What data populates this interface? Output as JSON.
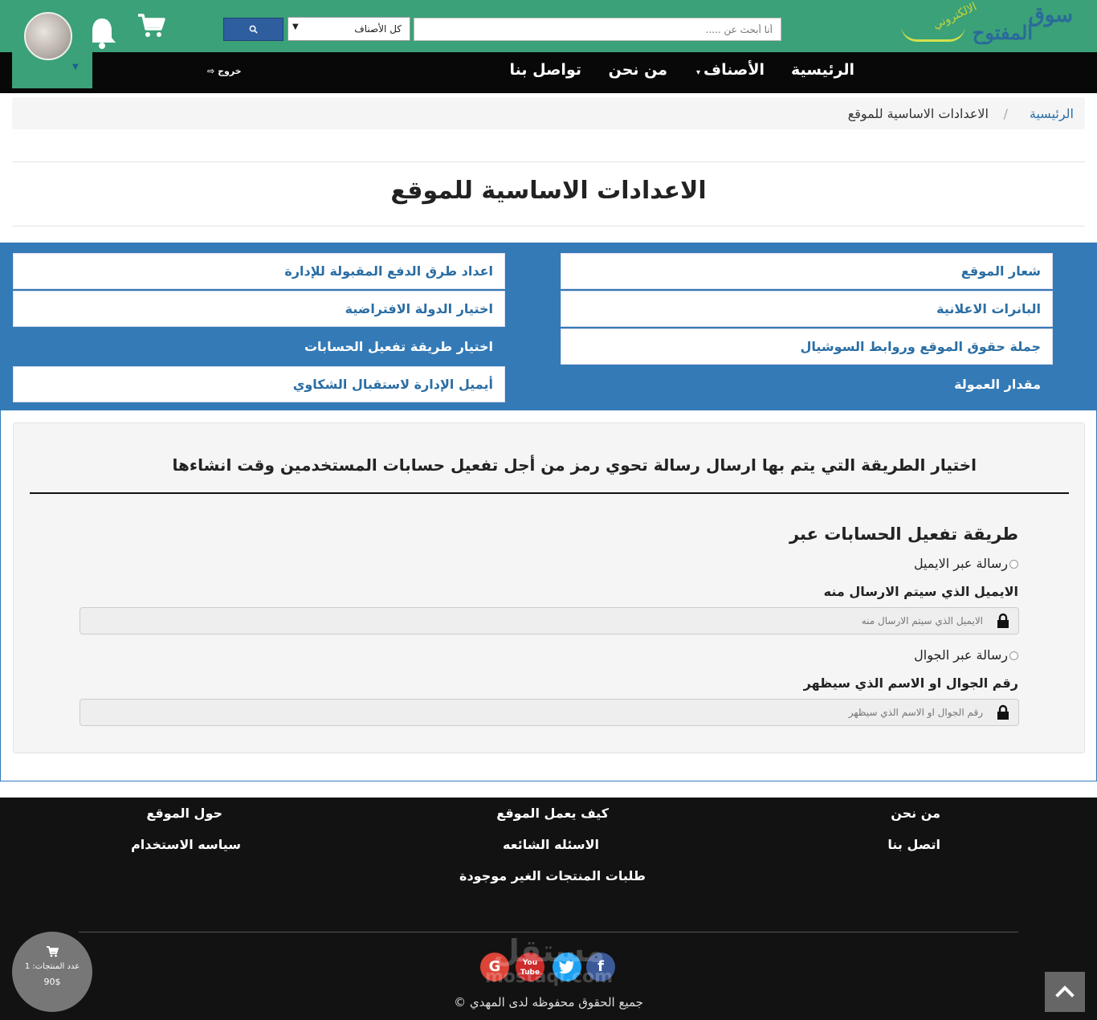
{
  "header": {
    "logo_text_1": "سوق",
    "logo_text_2": "المفتوح",
    "logo_text_3": "الالكتروني",
    "search_placeholder": "أنا أبحث عن .....",
    "category_selected": "كل الأصناف",
    "search_button_icon": "search-icon",
    "cart_icon": "cart-icon",
    "bell_icon": "bell-icon"
  },
  "nav": {
    "home": "الرئيسية",
    "categories": "الأصناف",
    "about": "من نحن",
    "contact": "تواصل بنا",
    "logout": "خروج"
  },
  "breadcrumb": {
    "home": "الرئيسية",
    "separator": "/",
    "current": "الاعدادات الاساسية للموقع"
  },
  "page_title": "الاعدادات الاساسية للموقع",
  "settings_menu": {
    "right": [
      {
        "label": "شعار الموقع",
        "active": false
      },
      {
        "label": "البانرات الاعلانية",
        "active": false
      },
      {
        "label": "جملة حقوق الموقع وروابط السوشيال",
        "active": false
      },
      {
        "label": "مقدار العمولة",
        "active": true
      }
    ],
    "left": [
      {
        "label": "اعداد طرق الدفع المقبولة للإدارة",
        "active": false
      },
      {
        "label": "اختيار الدولة الافتراضية",
        "active": false
      },
      {
        "label": "اختيار طريقة تفعيل الحسابات",
        "active": true
      },
      {
        "label": "أيميل الإدارة لاستقبال الشكاوي",
        "active": false
      }
    ]
  },
  "form": {
    "heading": "اختيار الطريقة التي يتم بها ارسال رسالة تحوي رمز من أجل تفعيل حسابات المستخدمين وقت انشاءها",
    "section_title": "طريقة تفعيل الحسابات عبر",
    "email_option": "رسالة عبر الايميل",
    "email_label": "الايميل الذي سيتم الارسال منه",
    "email_placeholder": "الايميل الذي سيتم الارسال منه",
    "sms_option": "رسالة عبر الجوال",
    "sms_label": "رقم الجوال او الاسم الذي سيظهر",
    "sms_placeholder": "رقم الجوال او الاسم الذي سيظهر"
  },
  "footer": {
    "about": "من نحن",
    "contact": "اتصل بنا",
    "how_it_works": "كيف يعمل الموقع",
    "faq": "الاسئله الشائعه",
    "missing_products": "طلبات المنتجات الغير موجودة",
    "about_site": "حول الموقع",
    "terms": "سياسه الاستخدام",
    "social": {
      "facebook": "f",
      "youtube": "You Tube",
      "google": "G"
    },
    "watermark_1": "مستقل",
    "watermark_2": "mostaql.com",
    "copyright": "جميع الحقوق محفوظه لدى المهدي ©"
  },
  "floating_cart": {
    "count_text": "عدد المنتجات: 1",
    "price_text": "90$"
  },
  "colors": {
    "header_green": "#3aa178",
    "primary_blue": "#337ab7",
    "nav_black": "#080808",
    "footer_black": "#121212"
  }
}
